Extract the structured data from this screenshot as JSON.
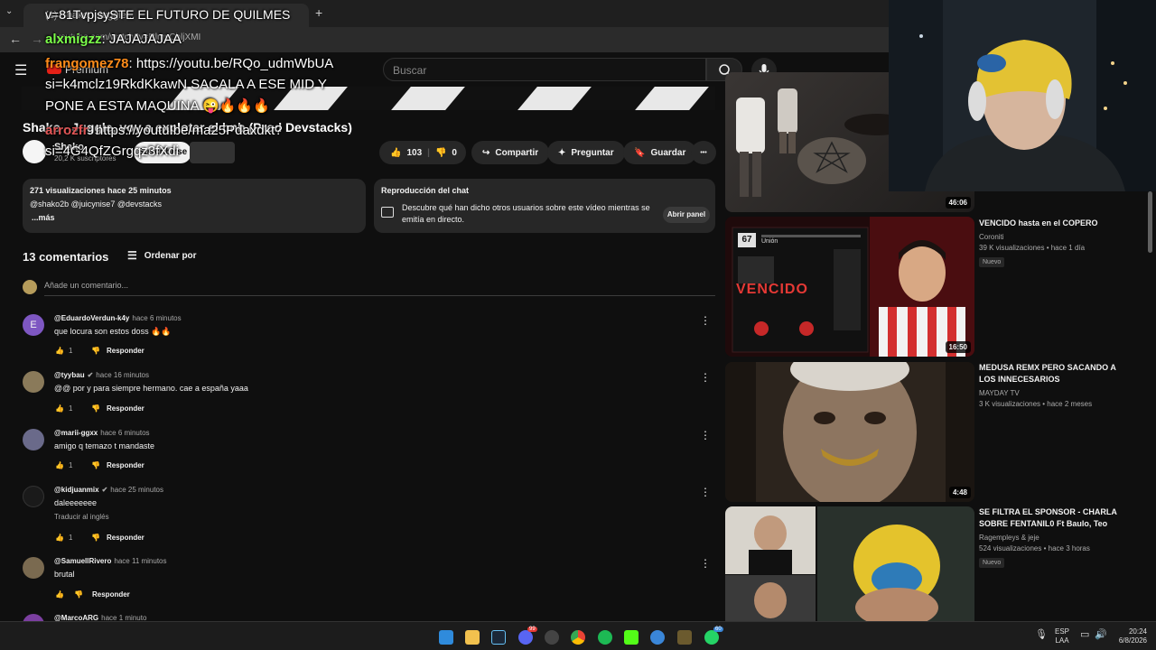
{
  "browser": {
    "tab_title": "(1) Shako - Juggle...",
    "url": "youtube.com/watch?v=RlmyChljXMI"
  },
  "header": {
    "premium_label": "Premium",
    "search_placeholder": "Buscar"
  },
  "video": {
    "title": "Shako - Juggle, voy a explotar el bnb (Prod Devstacks)",
    "channel": "Shako",
    "subscribers": "20,2 K suscriptores",
    "subscribe_label": "Suscribirse",
    "likes": "103",
    "dislikes": "0",
    "share_label": "Compartir",
    "ask_label": "Preguntar",
    "save_label": "Guardar",
    "more_label": "•••"
  },
  "description": {
    "meta": "271 visualizaciones  hace 25 minutos",
    "tags": "@shako2b @juicynise7 @devstacks",
    "more": "...más"
  },
  "chat_replay": {
    "title": "Reproducción del chat",
    "text": "Descubre qué han dicho otros usuarios sobre este vídeo mientras se emitía en directo.",
    "button": "Abrir panel"
  },
  "comments_section": {
    "count": "13 comentarios",
    "sort_label": "Ordenar por",
    "add_placeholder": "Añade un comentario..."
  },
  "comments": [
    {
      "author": "@EduardoVerdun-k4y",
      "time": "hace 6 minutos",
      "text": "que locura son estos doss 🔥🔥",
      "likes": "1",
      "reply": "Responder",
      "avatar_letter": "E",
      "avatar_color": "#7e57c2"
    },
    {
      "author": "@tyybau",
      "time": "hace 16 minutos",
      "text": "@@ por y para siempre hermano. cae a españa yaaa",
      "likes": "1",
      "reply": "Responder",
      "avatar_color": "#8a7a5a"
    },
    {
      "author": "@marii-ggxx",
      "time": "hace 6 minutos",
      "text": "amigo q temazo t mandaste",
      "likes": "1",
      "reply": "Responder",
      "avatar_color": "#6a6a8a"
    },
    {
      "author": "@kidjuanmix",
      "time": "hace 25 minutos",
      "text": "daleeeeeee",
      "translate": "Traducir al inglés",
      "likes": "1",
      "reply": "Responder",
      "avatar_color": "#1a1a1a"
    },
    {
      "author": "@SamuellRivero",
      "time": "hace 11 minutos",
      "text": "brutal",
      "likes": "",
      "reply": "Responder",
      "avatar_color": "#7a6a50"
    },
    {
      "author": "@MarcoARG",
      "time": "hace 1 minuto",
      "text": "",
      "likes": "",
      "reply": "",
      "avatar_color": "#7b3fa0"
    }
  ],
  "sidebar": [
    {
      "title": "",
      "channel": "",
      "meta": "",
      "duration": "46:06",
      "badge": ""
    },
    {
      "title": "VENCIDO hasta en el COPERO",
      "channel": "Coroniti",
      "meta": "39 K visualizaciones • hace 1 día",
      "duration": "16:50",
      "badge": "Nuevo"
    },
    {
      "title": "MEDUSA REMX PERO SACANDO A LOS INNECESARIOS",
      "channel": "MAYDAY TV",
      "meta": "3 K visualizaciones • hace 2 meses",
      "duration": "4:48",
      "badge": ""
    },
    {
      "title": "SE FILTRA EL SPONSOR - CHARLA SOBRE FENTANIL0 Ft Baulo, Teo",
      "channel": "Ragempleys & jeje",
      "meta": "524 visualizaciones • hace 3 horas",
      "duration": "",
      "badge": "Nuevo"
    }
  ],
  "thumb_text": {
    "vencido": "VENCIDO",
    "score": "67",
    "team": "Unión"
  },
  "chat_overlay": [
    {
      "user": "",
      "msg": "v=81TvpjsySTE EL FUTURO DE QUILMES"
    },
    {
      "user": "alxmigzz",
      "msg": ": JAJAJAJAA"
    },
    {
      "user": "frangomez78",
      "msg": ": https://youtu.be/RQo_udmWbUA"
    },
    {
      "user": "",
      "msg": "si=k4mclz19RkdKkawN SACALA A ESE MID Y"
    },
    {
      "user": "",
      "msg": "PONE A ESTA MAQUINA 😜🔥🔥🔥"
    },
    {
      "user": "arrozfr",
      "msg": ": https://youtu.be/ma25Pdaxdkt?"
    },
    {
      "user": "",
      "msg": "si=4G4QfZGrgqz3fXdi"
    }
  ],
  "taskbar": {
    "lang": "ESP",
    "lang2": "LAA",
    "time": "20:24",
    "date": "6/8/2026",
    "discord_badge": "99",
    "whatsapp_badge": "60"
  }
}
